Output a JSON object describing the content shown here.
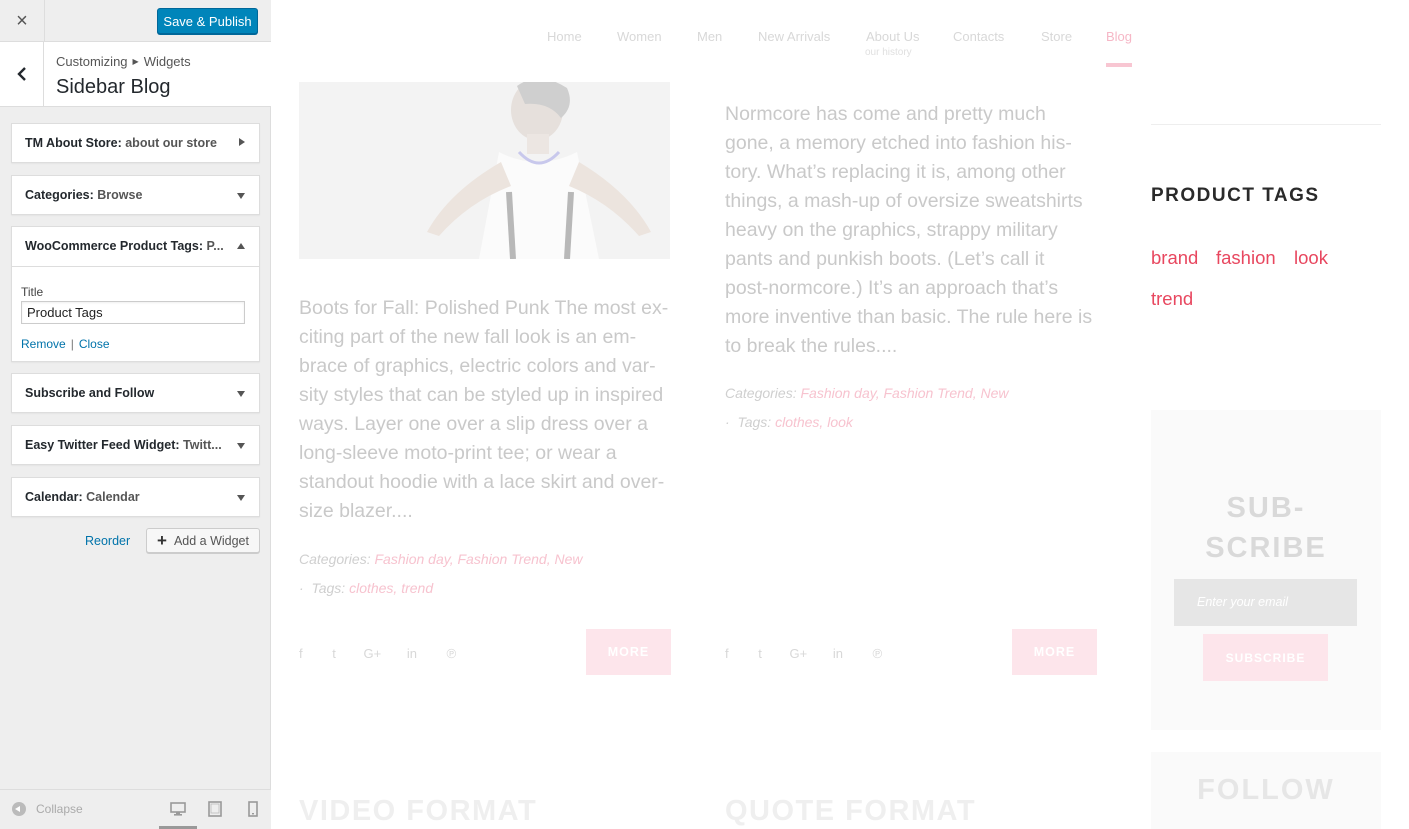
{
  "customizer": {
    "close_label": "×",
    "publish_label": "Save & Publish",
    "breadcrumb": {
      "root": "Customizing",
      "section": "Widgets"
    },
    "section_title": "Sidebar Blog",
    "widgets": [
      {
        "name": "TM About Store:",
        "subtitle": "about our store",
        "state": "collapsed-right"
      },
      {
        "name": "Categories:",
        "subtitle": "Browse",
        "state": "collapsed"
      },
      {
        "name": "WooCommerce Product Tags:",
        "subtitle": "P...",
        "state": "expanded"
      },
      {
        "name": "Subscribe and Follow",
        "subtitle": "",
        "state": "collapsed"
      },
      {
        "name": "Easy Twitter Feed Widget:",
        "subtitle": "Twitt...",
        "state": "collapsed"
      },
      {
        "name": "Calendar:",
        "subtitle": "Calendar",
        "state": "collapsed"
      }
    ],
    "open_widget": {
      "field_label": "Title",
      "field_value": "Product Tags",
      "remove_label": "Remove",
      "separator": "|",
      "close_label": "Close"
    },
    "reorder_label": "Reorder",
    "add_widget_label": "Add a Widget",
    "collapse_label": "Collapse",
    "accent_color": "#0085ba"
  },
  "preview": {
    "nav": [
      {
        "label": "Home"
      },
      {
        "label": "Women"
      },
      {
        "label": "Men"
      },
      {
        "label": "New Arrivals"
      },
      {
        "label": "About Us",
        "sub": "our history"
      },
      {
        "label": "Contacts"
      },
      {
        "label": "Store"
      },
      {
        "label": "Blog",
        "active": true
      }
    ],
    "posts": [
      {
        "excerpt_lines": [
          "Boots for Fall: Polished Punk The most ex-",
          "citing part of the new fall look is an em-",
          "brace of graphics, electric colors and var-",
          "sity styles that can be styled up in inspired",
          "ways. Layer one over a slip dress over a",
          "long-sleeve moto-print tee; or wear a",
          "standout hoodie with a lace skirt and over-",
          "size blazer...."
        ],
        "categories_label": "Categories:",
        "categories": "Fashion day, Fashion Trend, New",
        "tags_label": "Tags:",
        "tags": "clothes, trend",
        "more_label": "MORE"
      },
      {
        "excerpt_lines": [
          "Normcore has come and pretty much",
          "gone, a memory etched into fashion his-",
          "tory. What’s replacing it is, among other",
          "things, a mash-up of oversize sweatshirts",
          "heavy on the graphics, strappy military",
          "pants and punkish boots. (Let’s call it",
          "post-normcore.) It’s an approach that’s",
          "more inventive than basic. The rule here is",
          "to break the rules...."
        ],
        "categories_label": "Categories:",
        "categories": "Fashion day, Fashion Trend, New",
        "tags_label": "Tags:",
        "tags": "clothes, look",
        "more_label": "MORE"
      }
    ],
    "product_tags": {
      "title": "PRODUCT TAGS",
      "tags": [
        "brand",
        "fashion",
        "look",
        "trend"
      ],
      "color": "#e8475f"
    },
    "subscribe": {
      "title_line1": "SUB-",
      "title_line2": "SCRIBE",
      "placeholder": "Enter your email",
      "button_label": "SUBSCRIBE"
    },
    "follow_title": "FOLLOW",
    "section_titles": [
      "VIDEO FORMAT",
      "QUOTE FORMAT"
    ]
  }
}
